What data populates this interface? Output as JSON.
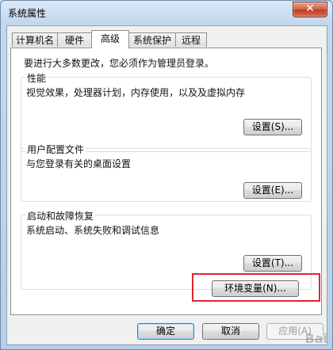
{
  "window": {
    "title": "系统属性",
    "close_glyph": "✕"
  },
  "tabs": [
    {
      "label": "计算机名",
      "active": false
    },
    {
      "label": "硬件",
      "active": false
    },
    {
      "label": "高级",
      "active": true
    },
    {
      "label": "系统保护",
      "active": false
    },
    {
      "label": "远程",
      "active": false
    }
  ],
  "panel": {
    "admin_note": "要进行大多数更改，您必须作为管理员登录。",
    "performance": {
      "title": "性能",
      "description": "视觉效果，处理器计划，内存使用，以及及虚拟内存",
      "button": "设置(S)..."
    },
    "user_profiles": {
      "title": "用户配置文件",
      "description": "与您登录有关的桌面设置",
      "button": "设置(E)..."
    },
    "startup_recovery": {
      "title": "启动和故障恢复",
      "description": "系统启动、系统失败和调试信息",
      "button": "设置(T)..."
    },
    "env_button": "环境变量(N)..."
  },
  "footer": {
    "ok": "确定",
    "cancel": "取消",
    "apply": "应用(A)"
  },
  "colors": {
    "highlight": "#e0262c"
  },
  "watermark": "Bai"
}
